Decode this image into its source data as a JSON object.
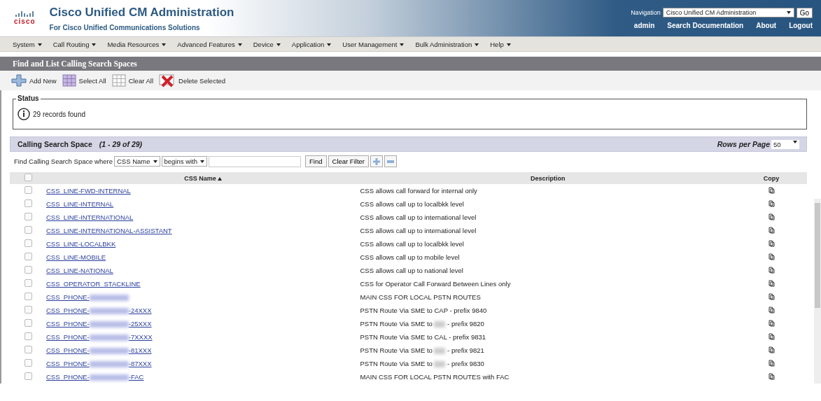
{
  "header": {
    "logo_text": "cisco",
    "title": "Cisco Unified CM Administration",
    "subtitle": "For Cisco Unified Communications Solutions",
    "navigation_label": "Navigation",
    "navigation_value": "Cisco Unified CM Administration",
    "go_button": "Go",
    "user": "admin",
    "links": [
      "Search Documentation",
      "About",
      "Logout"
    ]
  },
  "menu": [
    "System",
    "Call Routing",
    "Media Resources",
    "Advanced Features",
    "Device",
    "Application",
    "User Management",
    "Bulk Administration",
    "Help"
  ],
  "page_title": "Find and List Calling Search Spaces",
  "toolbar": [
    {
      "kind": "add",
      "label": "Add New"
    },
    {
      "kind": "select",
      "label": "Select All"
    },
    {
      "kind": "clear",
      "label": "Clear All"
    },
    {
      "kind": "delete",
      "label": "Delete Selected"
    }
  ],
  "status": {
    "legend": "Status",
    "message": "29 records found"
  },
  "section": {
    "title": "Calling Search Space",
    "range": "(1 - 29 of 29)",
    "rows_per_page_label": "Rows per Page",
    "rows_per_page": "50"
  },
  "filter": {
    "label": "Find Calling Search Space where",
    "field": "CSS Name",
    "operator": "begins with",
    "find_button": "Find",
    "clear_button": "Clear Filter"
  },
  "table": {
    "select_all_checked": false,
    "columns": [
      {
        "label": "CSS Name",
        "sorted": true
      },
      {
        "label": "Description",
        "sorted": false
      },
      {
        "label": "Copy",
        "sorted": false
      }
    ],
    "rows": [
      {
        "checked": false,
        "name": [
          "CSS_LINE-FWD-INTERNAL"
        ],
        "description": [
          "CSS allows call forward for internal only"
        ]
      },
      {
        "checked": false,
        "name": [
          "CSS_LINE-INTERNAL"
        ],
        "description": [
          "CSS allows call up to localbkk level"
        ]
      },
      {
        "checked": false,
        "name": [
          "CSS_LINE-INTERNATIONAL"
        ],
        "description": [
          "CSS allows call up to international level"
        ]
      },
      {
        "checked": false,
        "name": [
          "CSS_LINE-INTERNATIONAL-ASSISTANT"
        ],
        "description": [
          "CSS allows call up to international level"
        ]
      },
      {
        "checked": false,
        "name": [
          "CSS_LINE-LOCALBKK"
        ],
        "description": [
          "CSS allows call up to localbkk level"
        ]
      },
      {
        "checked": false,
        "name": [
          "CSS_LINE-MOBILE"
        ],
        "description": [
          "CSS allows call up to mobile level"
        ]
      },
      {
        "checked": false,
        "name": [
          "CSS_LINE-NATIONAL"
        ],
        "description": [
          "CSS allows call up to national level"
        ]
      },
      {
        "checked": false,
        "name": [
          "CSS_OPERATOR_STACKLINE"
        ],
        "description": [
          "CSS for Operator Call Forward Between Lines only"
        ]
      },
      {
        "checked": false,
        "name": [
          "CSS_PHONE-"
        ],
        "name_redacted": true,
        "description": [
          "MAIN CSS FOR LOCAL PSTN ROUTES"
        ]
      },
      {
        "checked": false,
        "name": [
          "CSS_PHONE-",
          "-24XXX"
        ],
        "description": [
          "PSTN Route Via SME to CAP - prefix 9840"
        ]
      },
      {
        "checked": false,
        "name": [
          "CSS_PHONE-",
          "-25XXX"
        ],
        "description": [
          "PSTN Route Via SME to",
          "- prefix 9820"
        ]
      },
      {
        "checked": false,
        "name": [
          "CSS_PHONE-",
          "-7XXXX"
        ],
        "description": [
          "PSTN Route Via SME to CAL - prefix 9831"
        ]
      },
      {
        "checked": false,
        "name": [
          "CSS_PHONE-",
          "-81XXX"
        ],
        "description": [
          "PSTN Route Via SME to",
          "- prefix 9821"
        ]
      },
      {
        "checked": false,
        "name": [
          "CSS_PHONE-",
          "-87XXX"
        ],
        "description": [
          "PSTN Route Via SME to",
          "- prefix 9830"
        ]
      },
      {
        "checked": false,
        "name": [
          "CSS_PHONE-",
          "-FAC"
        ],
        "description": [
          "MAIN CSS FOR LOCAL PSTN ROUTES with FAC"
        ]
      }
    ]
  }
}
